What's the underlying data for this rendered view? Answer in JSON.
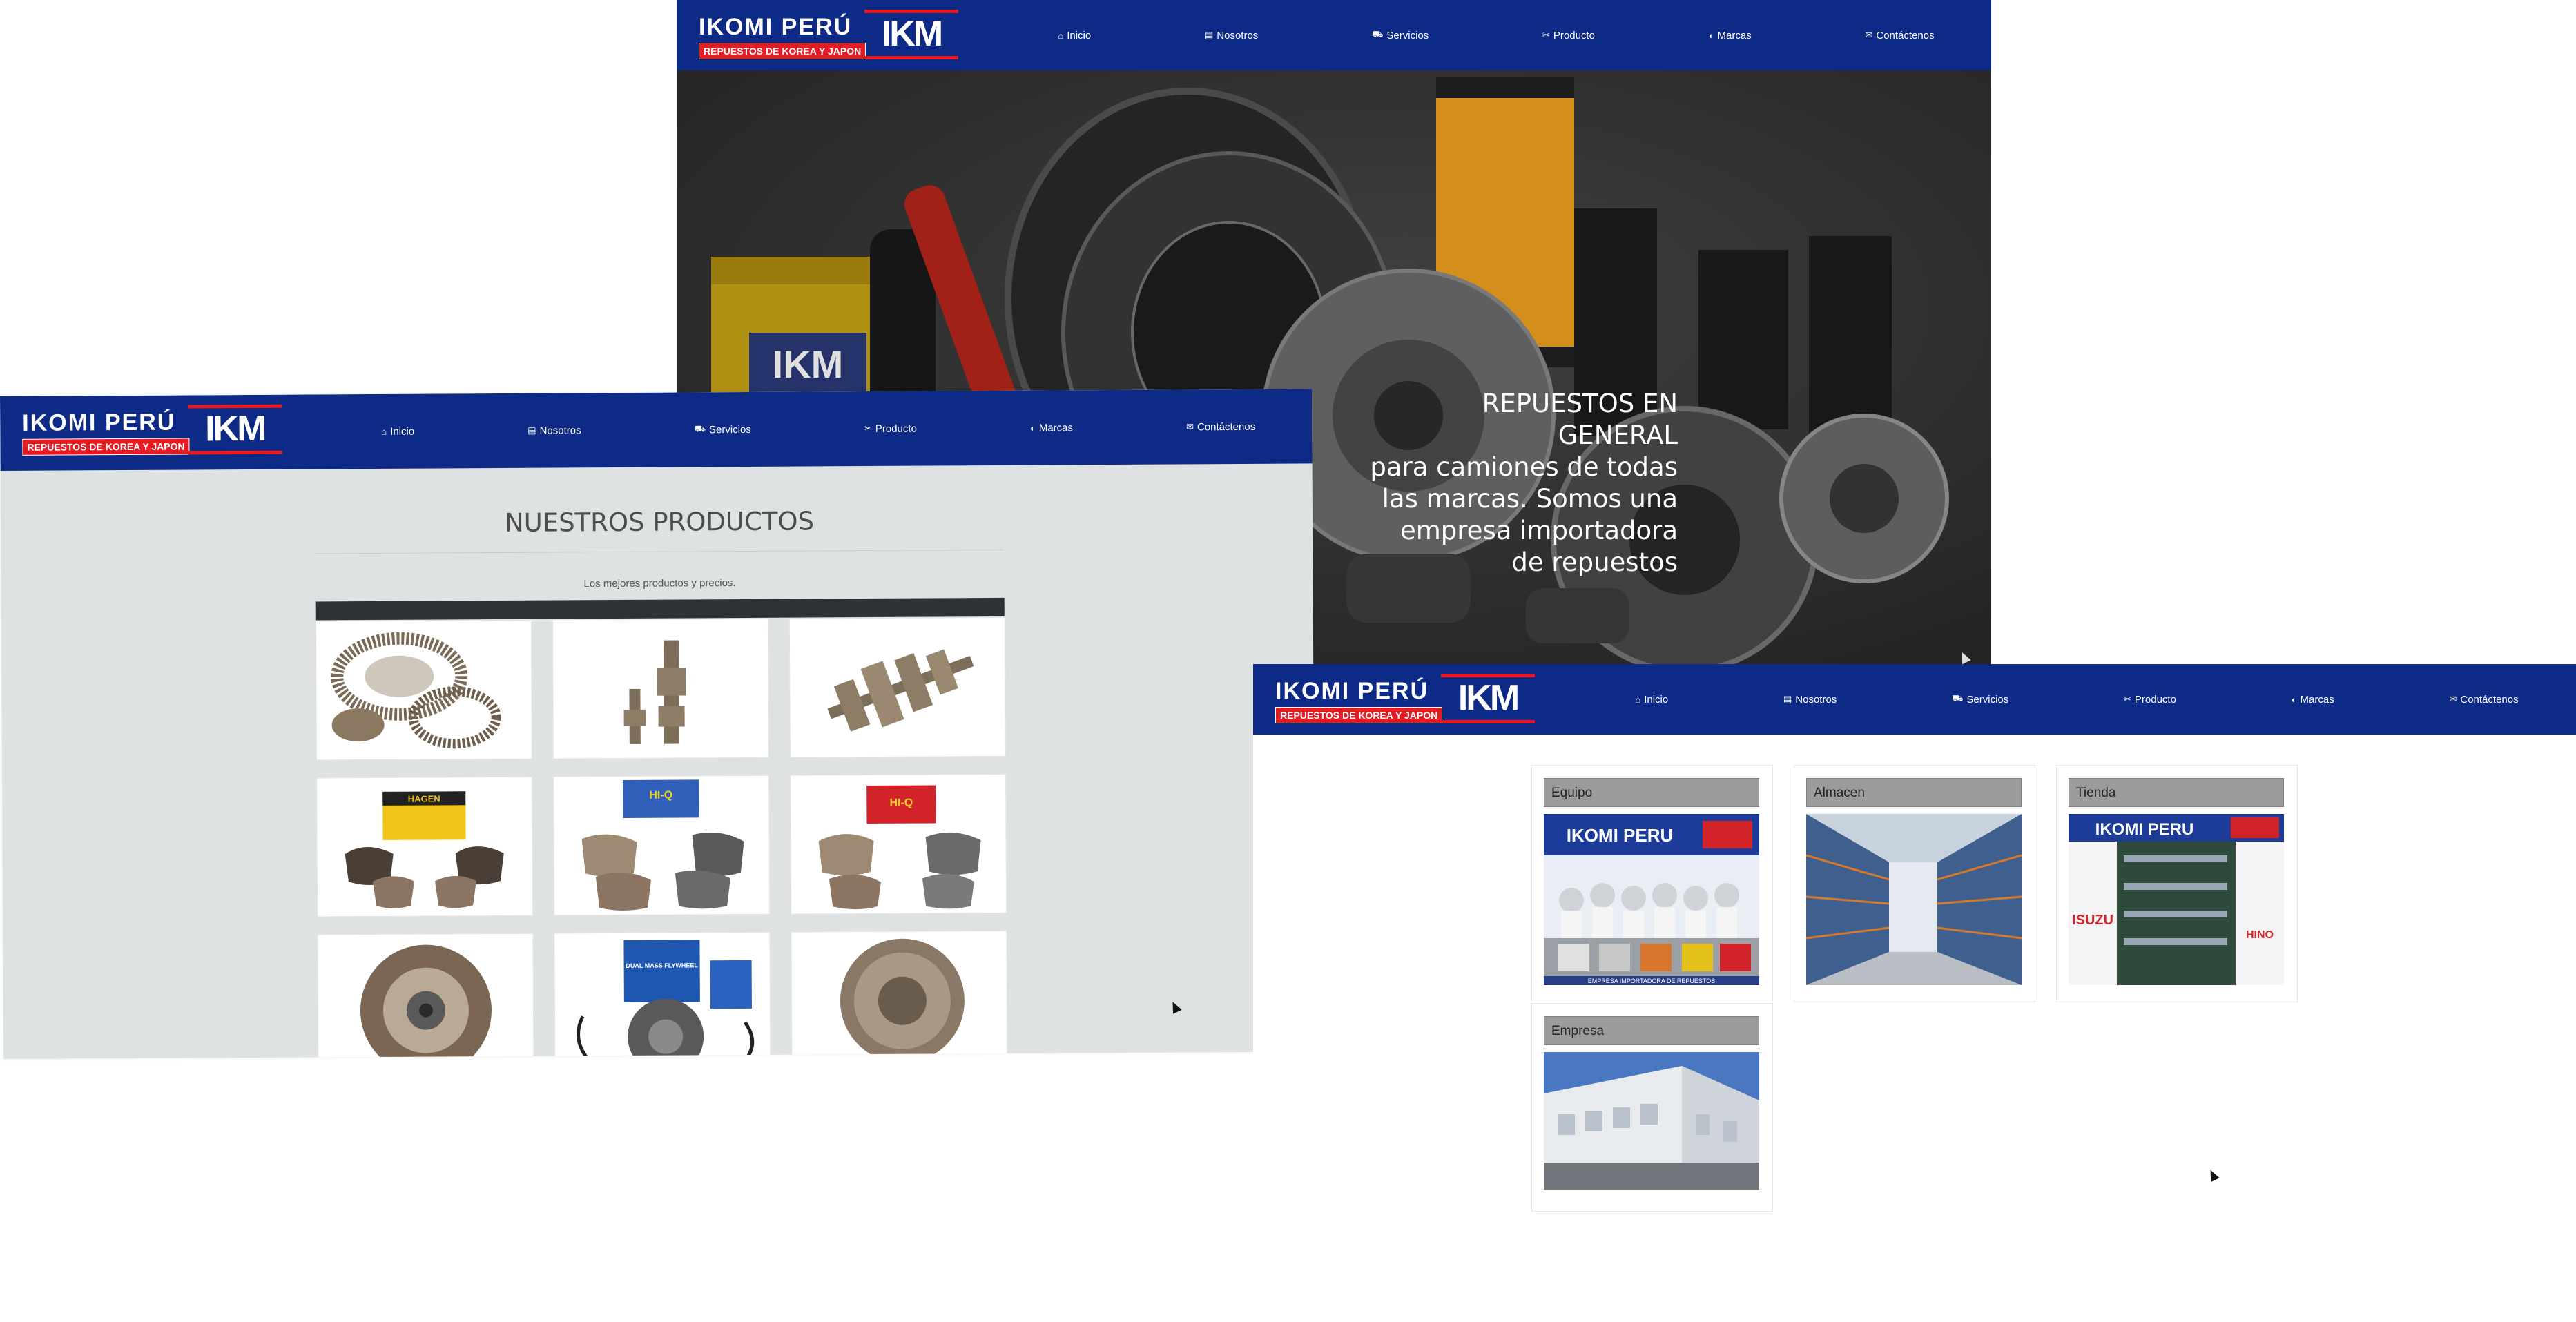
{
  "brand": {
    "name": "IKOMI PERÚ",
    "tagline": "REPUESTOS DE KOREA Y JAPON",
    "mark": "IKM",
    "colors": {
      "navy": "#0d2a86",
      "red": "#e51b24"
    }
  },
  "nav": [
    {
      "label": "Inicio",
      "icon": "home-icon",
      "glyph": "⌂"
    },
    {
      "label": "Nosotros",
      "icon": "building-icon",
      "glyph": "▤"
    },
    {
      "label": "Servicios",
      "icon": "car-icon",
      "glyph": "⛟"
    },
    {
      "label": "Producto",
      "icon": "tools-icon",
      "glyph": "✂"
    },
    {
      "label": "Marcas",
      "icon": "shield-icon",
      "glyph": "◐"
    },
    {
      "label": "Contáctenos",
      "icon": "envelope-icon",
      "glyph": "✉"
    }
  ],
  "hero": {
    "line1": "REPUESTOS EN GENERAL",
    "rest": "para camiones de todas las marcas. Somos una empresa importadora de repuestos",
    "box_mark": "IKM"
  },
  "products": {
    "title": "NUESTROS PRODUCTOS",
    "subtitle": "Los mejores productos y precios.",
    "items": [
      {
        "icon": "ring-gear-icon"
      },
      {
        "icon": "shaft-icon"
      },
      {
        "icon": "gear-set-icon"
      },
      {
        "icon": "brake-pads-icon",
        "box_text": "HAGEN"
      },
      {
        "icon": "brake-pads-icon",
        "box_text": "HI-Q"
      },
      {
        "icon": "brake-pads-icon",
        "box_text": "HI-Q"
      },
      {
        "icon": "clutch-disc-icon"
      },
      {
        "icon": "clutch-kit-icon",
        "box_text": "DUAL MASS FLYWHEEL"
      },
      {
        "icon": "pressure-plate-icon"
      }
    ]
  },
  "gallery": [
    {
      "label": "Equipo",
      "sign": "IKOMI PERU",
      "caption": "EMPRESA IMPORTADORA DE REPUESTOS"
    },
    {
      "label": "Almacen"
    },
    {
      "label": "Tienda",
      "sign": "IKOMI PERU",
      "brands": [
        "ISUZU",
        "HINO"
      ]
    },
    {
      "label": "Empresa"
    }
  ]
}
